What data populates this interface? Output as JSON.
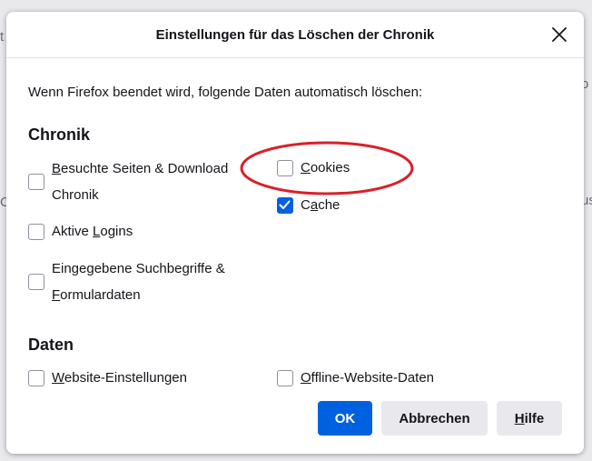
{
  "dialog": {
    "title": "Einstellungen für das Löschen der Chronik",
    "intro": "Wenn Firefox beendet wird, folgende Daten automatisch löschen:"
  },
  "sections": {
    "chronik": "Chronik",
    "daten": "Daten"
  },
  "checkboxes": {
    "visited_line1": "Besuchte Seiten & Download",
    "visited_line2": "Chronik",
    "cookies": "Cookies",
    "cache": "Cache",
    "logins": "Aktive Logins",
    "search_line1": "Eingegebene Suchbegriffe &",
    "search_line2": "Formulardaten",
    "site_settings": "Website-Einstellungen",
    "offline_data": "Offline-Website-Daten"
  },
  "states": {
    "visited": false,
    "cookies": false,
    "cache": true,
    "logins": false,
    "search": false,
    "site_settings": false,
    "offline_data": false
  },
  "buttons": {
    "ok": "OK",
    "cancel": "Abbrechen",
    "help": "Hilfe"
  },
  "colors": {
    "accent": "#0061e0",
    "annotation": "#d9202a"
  },
  "icons": {
    "close": "close-icon",
    "check": "checkmark-icon"
  }
}
